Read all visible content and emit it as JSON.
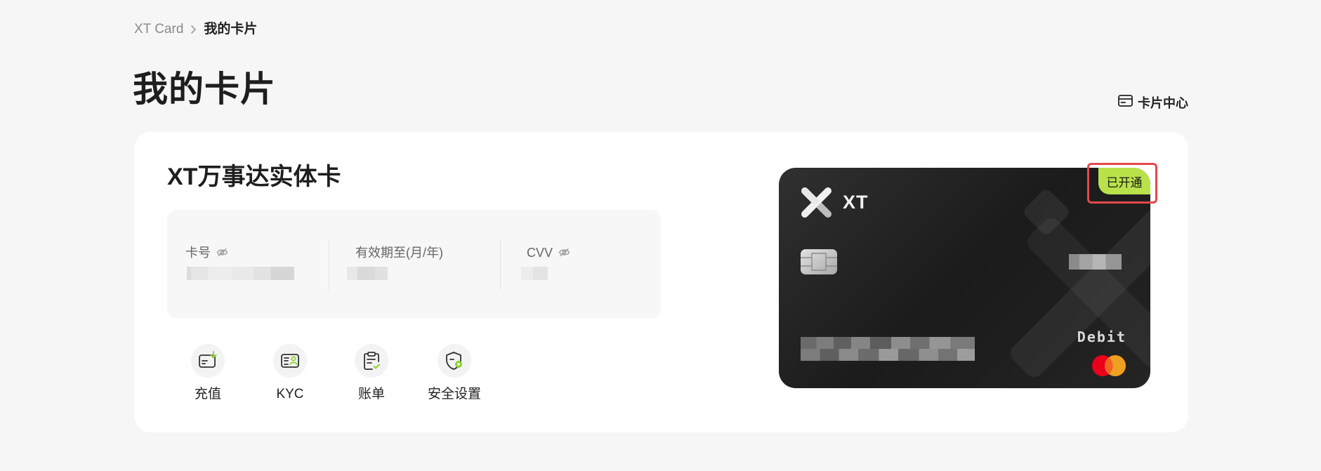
{
  "breadcrumb": {
    "items": [
      "XT Card",
      "我的卡片"
    ],
    "separator_icon": "chevron-right-icon"
  },
  "page_title": "我的卡片",
  "card_center": {
    "label": "卡片中心",
    "icon": "card-icon"
  },
  "main": {
    "card_name": "XT万事达实体卡",
    "fields": [
      {
        "label": "卡号",
        "icon": "eye-off-icon",
        "value_masked": true
      },
      {
        "label": "有效期至(月/年)",
        "value_masked": true
      },
      {
        "label": "CVV",
        "icon": "eye-off-icon",
        "value_masked": true
      }
    ],
    "actions": [
      {
        "label": "充值",
        "icon": "deposit-icon"
      },
      {
        "label": "KYC",
        "icon": "kyc-icon"
      },
      {
        "label": "账单",
        "icon": "bill-icon"
      },
      {
        "label": "安全设置",
        "icon": "security-settings-icon"
      }
    ]
  },
  "physical_card": {
    "brand": "XT",
    "status": "已开通",
    "type": "Debit",
    "network_icon": "mastercard-logo",
    "number_masked": true
  },
  "colors": {
    "page_bg": "#f6f6f6",
    "accent": "#b9e24a",
    "card_bg": "#1b1b1b",
    "highlight": "#e5484d"
  }
}
